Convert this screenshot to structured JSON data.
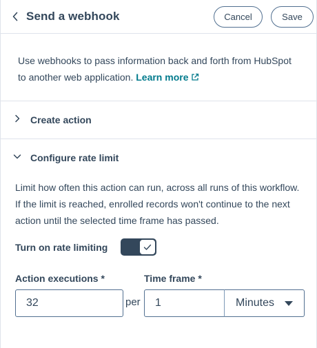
{
  "header": {
    "title": "Send a webhook",
    "cancel_label": "Cancel",
    "save_label": "Save"
  },
  "intro": {
    "text": "Use webhooks to pass information back and forth from HubSpot to another web application.",
    "link_label": "Learn more"
  },
  "sections": {
    "create_action": {
      "label": "Create action",
      "expanded": false
    },
    "rate_limit": {
      "label": "Configure rate limit",
      "expanded": true
    }
  },
  "rate_limit": {
    "description": "Limit how often this action can run, across all runs of this workflow. If the limit is reached, enrolled records won't continue to the next action until the selected time frame has passed.",
    "toggle_label": "Turn on rate limiting",
    "toggle_on": true,
    "executions_label": "Action executions *",
    "executions_value": "32",
    "per_label": "per",
    "timeframe_label": "Time frame *",
    "timeframe_value": "1",
    "unit_value": "Minutes"
  },
  "colors": {
    "text": "#33475b",
    "link": "#007a8c",
    "border": "#dfe3eb",
    "control_border": "#516f90"
  },
  "icons": {
    "back": "chevron-left-icon",
    "external": "external-link-icon",
    "collapsed": "chevron-right-icon",
    "expanded": "chevron-down-icon",
    "check": "check-icon",
    "dropdown": "caret-down-icon"
  }
}
